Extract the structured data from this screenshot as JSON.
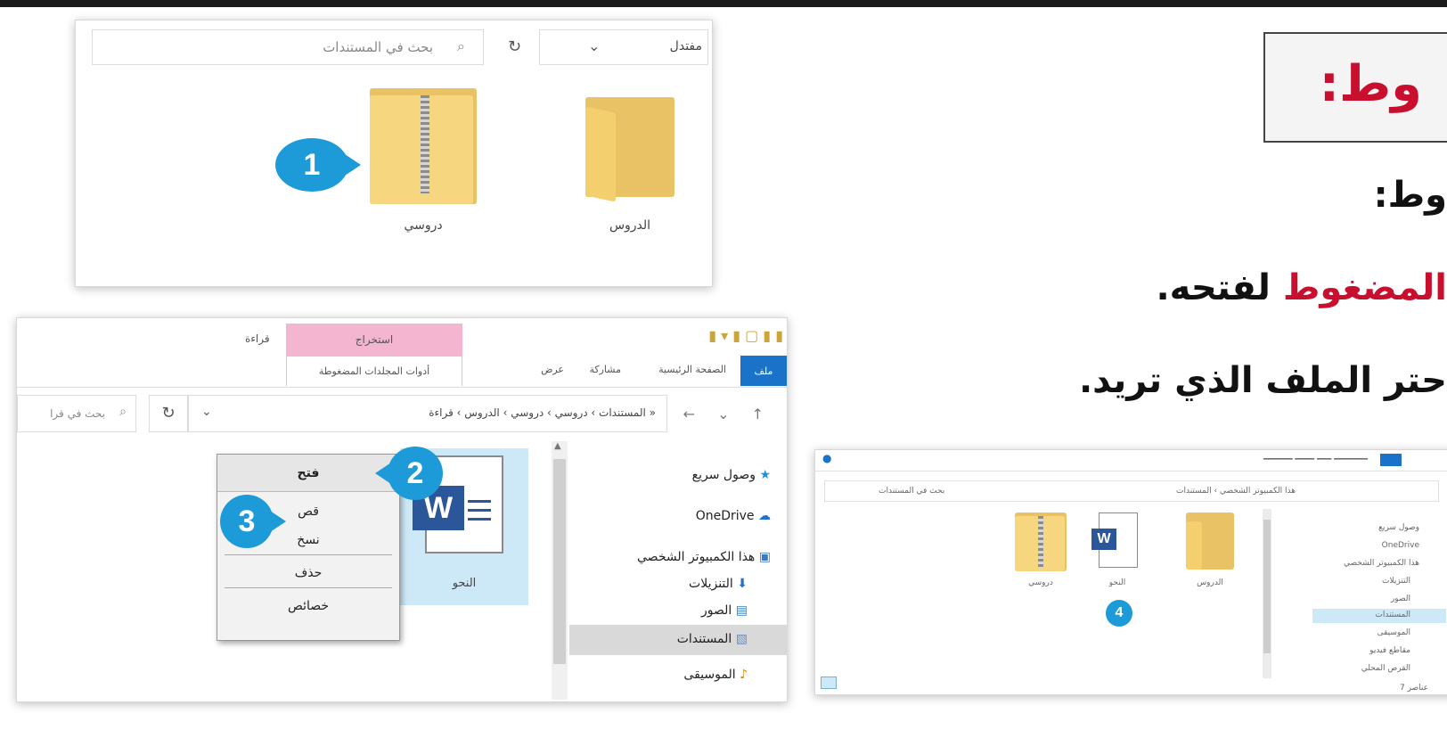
{
  "heading": {
    "title_fragment": "وط:",
    "line1": "وط:",
    "line2_red": "المضغوط",
    "line2_rest": "لفتحه.",
    "line3": "حتر الملف الذي تريد."
  },
  "panel1": {
    "address_fragment": "مفتدل",
    "search_placeholder": "بحث في المستندات",
    "folders": [
      {
        "label": "دروسي",
        "type": "zip"
      },
      {
        "label": "الدروس",
        "type": "folder"
      }
    ],
    "badge": "1"
  },
  "panel2": {
    "contextual_tab_title": "استخراج",
    "contextual_tab_group": "أدوات المجلدات المضغوطة",
    "read_label": "قراءة",
    "ribbon_tabs": [
      "ملف",
      "الصفحة الرئيسية",
      "مشاركة",
      "عرض"
    ],
    "breadcrumb": "« المستندات › دروسي › دروسي › الدروس › قراءة",
    "search_placeholder": "بحث في قرا",
    "nav_items": [
      {
        "label": "وصول سريع",
        "icon": "star-icon",
        "color": "#1e90e0"
      },
      {
        "label": "OneDrive",
        "icon": "cloud-icon",
        "color": "#1e72c8"
      },
      {
        "label": "هذا الكمبيوتر الشخصي",
        "icon": "computer-icon",
        "color": "#3a7bc8"
      },
      {
        "label": "التنزيلات",
        "icon": "download-icon",
        "color": "#2a6fc0"
      },
      {
        "label": "الصور",
        "icon": "pictures-icon",
        "color": "#3b82c4"
      },
      {
        "label": "المستندات",
        "icon": "documents-icon",
        "color": "#6c8ebf"
      },
      {
        "label": "الموسيقى",
        "icon": "music-icon",
        "color": "#d68a1a"
      }
    ],
    "file_label": "النحو",
    "context_menu": [
      "فتح",
      "قص",
      "نسخ",
      "حذف",
      "خصائص"
    ],
    "badges": [
      "2",
      "3"
    ]
  },
  "panel3": {
    "items": [
      {
        "label": "دروسي",
        "type": "zip"
      },
      {
        "label": "النحو",
        "type": "word"
      },
      {
        "label": "الدروس",
        "type": "folder"
      }
    ],
    "badge": "4",
    "nav_items": [
      "وصول سريع",
      "OneDrive",
      "هذا الكمبيوتر الشخصي",
      "التنزيلات",
      "الصور",
      "المستندات",
      "الموسيقى",
      "مقاطع فيديو",
      "القرص المحلي"
    ],
    "breadcrumb": "هذا الكمبيوتر الشخصي › المستندات",
    "search_placeholder": "بحث في المستندات",
    "status": "7 عناصر"
  },
  "colors": {
    "accent": "#1c9bd8",
    "red": "#c8102e",
    "ribbon_blue": "#1a73c8",
    "pink_tab": "#f3b5cf",
    "selected": "#cde8f7"
  }
}
